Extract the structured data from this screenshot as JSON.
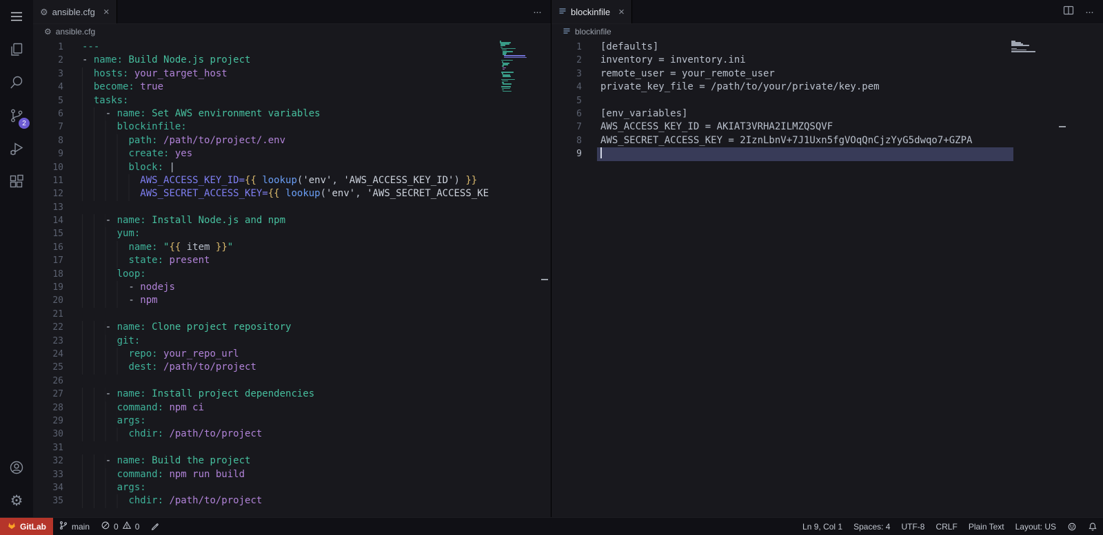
{
  "icons": {
    "gear": "⚙",
    "close": "×",
    "more": "···"
  },
  "colors": {
    "tokens": {
      "k": "#3fb39a",
      "g": "#47c09f",
      "v": "#b183d8",
      "b": "#7f7ff2",
      "j": "#d9b96c",
      "f": "#6a9ef5",
      "s": "#ccd2dc",
      "d": "#b9c0cc"
    },
    "current_line": "#383b58",
    "gitlab_bg": "#b5352a",
    "badge": "#6c5bd2"
  },
  "activity_bar": {
    "scm_badge": "2"
  },
  "groups": [
    {
      "tab": {
        "label": "ansible.cfg"
      },
      "breadcrumb": {
        "label": "ansible.cfg"
      },
      "lines": [
        {
          "n": 1,
          "tokens": [
            {
              "t": "---",
              "c": "k"
            }
          ]
        },
        {
          "n": 2,
          "tokens": [
            {
              "t": "- ",
              "c": "d"
            },
            {
              "t": "name:",
              "c": "k"
            },
            {
              "t": " Build Node.js project",
              "c": "g"
            }
          ]
        },
        {
          "n": 3,
          "tokens": [
            {
              "t": "  ",
              "c": "d"
            },
            {
              "t": "hosts:",
              "c": "k"
            },
            {
              "t": " your_target_host",
              "c": "v"
            }
          ]
        },
        {
          "n": 4,
          "tokens": [
            {
              "t": "  ",
              "c": "d"
            },
            {
              "t": "become:",
              "c": "k"
            },
            {
              "t": " true",
              "c": "v"
            }
          ]
        },
        {
          "n": 5,
          "tokens": [
            {
              "t": "  ",
              "c": "d"
            },
            {
              "t": "tasks:",
              "c": "k"
            }
          ]
        },
        {
          "n": 6,
          "tokens": [
            {
              "t": "    - ",
              "c": "d"
            },
            {
              "t": "name:",
              "c": "k"
            },
            {
              "t": " Set AWS environment variables",
              "c": "g"
            }
          ]
        },
        {
          "n": 7,
          "tokens": [
            {
              "t": "      ",
              "c": "d"
            },
            {
              "t": "blockinfile:",
              "c": "k"
            }
          ]
        },
        {
          "n": 8,
          "tokens": [
            {
              "t": "        ",
              "c": "d"
            },
            {
              "t": "path:",
              "c": "k"
            },
            {
              "t": " /path/to/project/.env",
              "c": "v"
            }
          ]
        },
        {
          "n": 9,
          "tokens": [
            {
              "t": "        ",
              "c": "d"
            },
            {
              "t": "create:",
              "c": "k"
            },
            {
              "t": " yes",
              "c": "v"
            }
          ]
        },
        {
          "n": 10,
          "tokens": [
            {
              "t": "        ",
              "c": "d"
            },
            {
              "t": "block:",
              "c": "k"
            },
            {
              "t": " |",
              "c": "d"
            }
          ]
        },
        {
          "n": 11,
          "tokens": [
            {
              "t": "          ",
              "c": "d"
            },
            {
              "t": "AWS_ACCESS_KEY_ID=",
              "c": "b"
            },
            {
              "t": "{{",
              "c": "j"
            },
            {
              "t": " ",
              "c": "d"
            },
            {
              "t": "lookup",
              "c": "f"
            },
            {
              "t": "(",
              "c": "d"
            },
            {
              "t": "'env'",
              "c": "s"
            },
            {
              "t": ", ",
              "c": "d"
            },
            {
              "t": "'AWS_ACCESS_KEY_ID'",
              "c": "s"
            },
            {
              "t": ") ",
              "c": "d"
            },
            {
              "t": "}}",
              "c": "j"
            }
          ]
        },
        {
          "n": 12,
          "tokens": [
            {
              "t": "          ",
              "c": "d"
            },
            {
              "t": "AWS_SECRET_ACCESS_KEY=",
              "c": "b"
            },
            {
              "t": "{{",
              "c": "j"
            },
            {
              "t": " ",
              "c": "d"
            },
            {
              "t": "lookup",
              "c": "f"
            },
            {
              "t": "(",
              "c": "d"
            },
            {
              "t": "'env'",
              "c": "s"
            },
            {
              "t": ", ",
              "c": "d"
            },
            {
              "t": "'AWS_SECRET_ACCESS_KE",
              "c": "s"
            }
          ]
        },
        {
          "n": 13,
          "tokens": []
        },
        {
          "n": 14,
          "tokens": [
            {
              "t": "    - ",
              "c": "d"
            },
            {
              "t": "name:",
              "c": "k"
            },
            {
              "t": " Install Node.js and npm",
              "c": "g"
            }
          ]
        },
        {
          "n": 15,
          "tokens": [
            {
              "t": "      ",
              "c": "d"
            },
            {
              "t": "yum:",
              "c": "k"
            }
          ]
        },
        {
          "n": 16,
          "tokens": [
            {
              "t": "        ",
              "c": "d"
            },
            {
              "t": "name:",
              "c": "k"
            },
            {
              "t": " ",
              "c": "d"
            },
            {
              "t": "\"",
              "c": "g"
            },
            {
              "t": "{{",
              "c": "j"
            },
            {
              "t": " item ",
              "c": "d"
            },
            {
              "t": "}}",
              "c": "j"
            },
            {
              "t": "\"",
              "c": "g"
            }
          ]
        },
        {
          "n": 17,
          "tokens": [
            {
              "t": "        ",
              "c": "d"
            },
            {
              "t": "state:",
              "c": "k"
            },
            {
              "t": " present",
              "c": "v"
            }
          ]
        },
        {
          "n": 18,
          "tokens": [
            {
              "t": "      ",
              "c": "d"
            },
            {
              "t": "loop:",
              "c": "k"
            }
          ]
        },
        {
          "n": 19,
          "tokens": [
            {
              "t": "        - ",
              "c": "d"
            },
            {
              "t": "nodejs",
              "c": "v"
            }
          ]
        },
        {
          "n": 20,
          "tokens": [
            {
              "t": "        - ",
              "c": "d"
            },
            {
              "t": "npm",
              "c": "v"
            }
          ]
        },
        {
          "n": 21,
          "tokens": []
        },
        {
          "n": 22,
          "tokens": [
            {
              "t": "    - ",
              "c": "d"
            },
            {
              "t": "name:",
              "c": "k"
            },
            {
              "t": " Clone project repository",
              "c": "g"
            }
          ]
        },
        {
          "n": 23,
          "tokens": [
            {
              "t": "      ",
              "c": "d"
            },
            {
              "t": "git:",
              "c": "k"
            }
          ]
        },
        {
          "n": 24,
          "tokens": [
            {
              "t": "        ",
              "c": "d"
            },
            {
              "t": "repo:",
              "c": "k"
            },
            {
              "t": " your_repo_url",
              "c": "v"
            }
          ]
        },
        {
          "n": 25,
          "tokens": [
            {
              "t": "        ",
              "c": "d"
            },
            {
              "t": "dest:",
              "c": "k"
            },
            {
              "t": " /path/to/project",
              "c": "v"
            }
          ]
        },
        {
          "n": 26,
          "tokens": []
        },
        {
          "n": 27,
          "tokens": [
            {
              "t": "    - ",
              "c": "d"
            },
            {
              "t": "name:",
              "c": "k"
            },
            {
              "t": " Install project dependencies",
              "c": "g"
            }
          ]
        },
        {
          "n": 28,
          "tokens": [
            {
              "t": "      ",
              "c": "d"
            },
            {
              "t": "command:",
              "c": "k"
            },
            {
              "t": " npm ci",
              "c": "v"
            }
          ]
        },
        {
          "n": 29,
          "tokens": [
            {
              "t": "      ",
              "c": "d"
            },
            {
              "t": "args:",
              "c": "k"
            }
          ]
        },
        {
          "n": 30,
          "tokens": [
            {
              "t": "        ",
              "c": "d"
            },
            {
              "t": "chdir:",
              "c": "k"
            },
            {
              "t": " /path/to/project",
              "c": "v"
            }
          ]
        },
        {
          "n": 31,
          "tokens": []
        },
        {
          "n": 32,
          "tokens": [
            {
              "t": "    - ",
              "c": "d"
            },
            {
              "t": "name:",
              "c": "k"
            },
            {
              "t": " Build the project",
              "c": "g"
            }
          ]
        },
        {
          "n": 33,
          "tokens": [
            {
              "t": "      ",
              "c": "d"
            },
            {
              "t": "command:",
              "c": "k"
            },
            {
              "t": " npm run build",
              "c": "v"
            }
          ]
        },
        {
          "n": 34,
          "tokens": [
            {
              "t": "      ",
              "c": "d"
            },
            {
              "t": "args:",
              "c": "k"
            }
          ]
        },
        {
          "n": 35,
          "tokens": [
            {
              "t": "        ",
              "c": "d"
            },
            {
              "t": "chdir:",
              "c": "k"
            },
            {
              "t": " /path/to/project",
              "c": "v"
            }
          ]
        }
      ]
    },
    {
      "tab": {
        "label": "blockinfile"
      },
      "breadcrumb": {
        "label": "blockinfile"
      },
      "cursor_line": 9,
      "lines": [
        {
          "n": 1,
          "text": "[defaults]"
        },
        {
          "n": 2,
          "text": "inventory = inventory.ini"
        },
        {
          "n": 3,
          "text": "remote_user = your_remote_user"
        },
        {
          "n": 4,
          "text": "private_key_file = /path/to/your/private/key.pem"
        },
        {
          "n": 5,
          "text": ""
        },
        {
          "n": 6,
          "text": "[env_variables]"
        },
        {
          "n": 7,
          "text": "AWS_ACCESS_KEY_ID = AKIAT3VRHA2ILMZQSQVF"
        },
        {
          "n": 8,
          "text": "AWS_SECRET_ACCESS_KEY = 2IznLbnV+7J1Uxn5fgVOqQnCjzYyG5dwqo7+GZPA"
        },
        {
          "n": 9,
          "text": ""
        }
      ]
    }
  ],
  "status_bar": {
    "gitlab": "GitLab",
    "branch": "main",
    "errors": "0",
    "warnings": "0",
    "line_col": "Ln 9, Col 1",
    "indent": "Spaces: 4",
    "encoding": "UTF-8",
    "eol": "CRLF",
    "language": "Plain Text",
    "layout": "Layout: US"
  }
}
